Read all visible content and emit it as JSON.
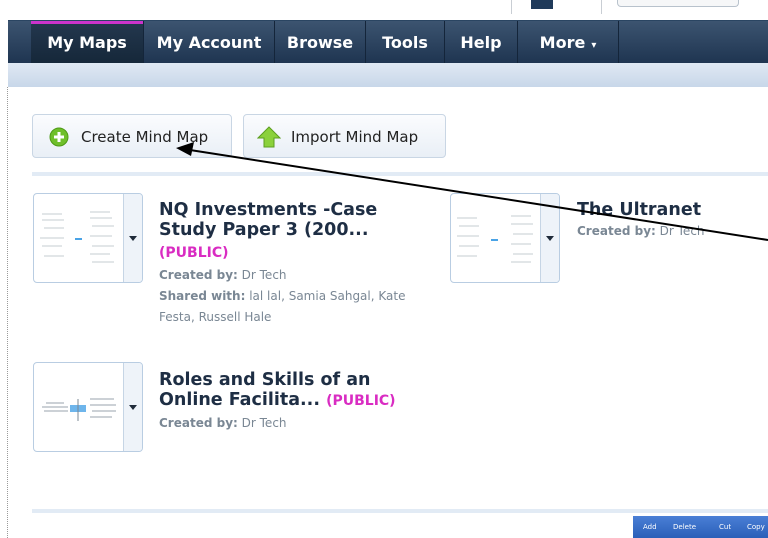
{
  "nav": {
    "items": [
      {
        "label": "My Maps",
        "active": true
      },
      {
        "label": "My Account"
      },
      {
        "label": "Browse"
      },
      {
        "label": "Tools"
      },
      {
        "label": "Help"
      },
      {
        "label": "More"
      }
    ],
    "more_caret": "▾"
  },
  "actions": {
    "create_label": "Create Mind Map",
    "import_label": "Import Mind Map"
  },
  "maps": [
    {
      "title_line1": "NQ Investments -Case",
      "title_line2": "Study Paper 3 (200...",
      "visibility": "(PUBLIC)",
      "created_label": "Created by:",
      "created_by": "Dr Tech",
      "shared_label": "Shared with:",
      "shared_line1": "lal lal, Samia Sahgal, Kate",
      "shared_line2": "Festa, Russell Hale"
    },
    {
      "title_line1": "The Ultranet",
      "created_label": "Created by:",
      "created_by": "Dr Tech"
    },
    {
      "title_line1": "Roles and Skills of an",
      "title_line2": "Online Facilita...",
      "visibility": "(PUBLIC)",
      "created_label": "Created by:",
      "created_by": "Dr Tech"
    }
  ],
  "mini_toolbar": {
    "add": "Add",
    "delete": "Delete",
    "cut": "Cut",
    "copy": "Copy"
  },
  "colors": {
    "nav_bg": "#1e3450",
    "active_indicator": "#cc33cc",
    "public_tag": "#d92cc2",
    "title_text": "#1e2e44"
  }
}
